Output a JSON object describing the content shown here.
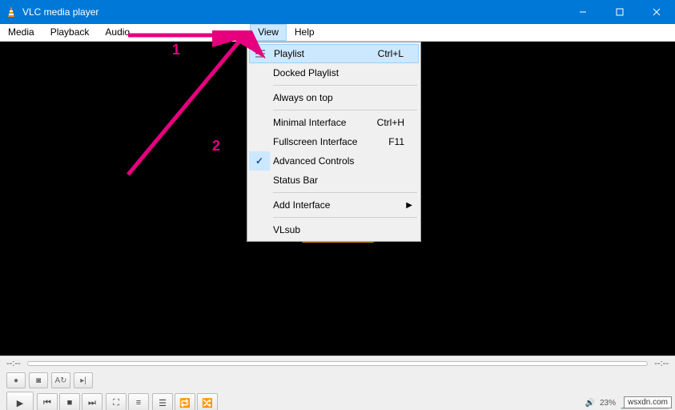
{
  "title": "VLC media player",
  "menubar": [
    "Media",
    "Playback",
    "Audio",
    "View",
    "Help"
  ],
  "menubar_open": "View",
  "dropdown": [
    {
      "icon": "playlist",
      "label": "Playlist",
      "accel": "Ctrl+L",
      "hl": true
    },
    {
      "label": "Docked Playlist"
    },
    {
      "sep": true
    },
    {
      "label": "Always on top"
    },
    {
      "sep": true
    },
    {
      "label": "Minimal Interface",
      "accel": "Ctrl+H"
    },
    {
      "label": "Fullscreen Interface",
      "accel": "F11"
    },
    {
      "icon": "check",
      "label": "Advanced Controls"
    },
    {
      "label": "Status Bar"
    },
    {
      "sep": true
    },
    {
      "label": "Add Interface",
      "submenu": true
    },
    {
      "sep": true
    },
    {
      "label": "VLsub"
    }
  ],
  "seek": {
    "time_left": "--:--",
    "time_right": "--:--"
  },
  "volume": {
    "percent": "23%"
  },
  "annotations": {
    "n1": "1",
    "n2": "2"
  },
  "watermark": "wsxdn.com"
}
